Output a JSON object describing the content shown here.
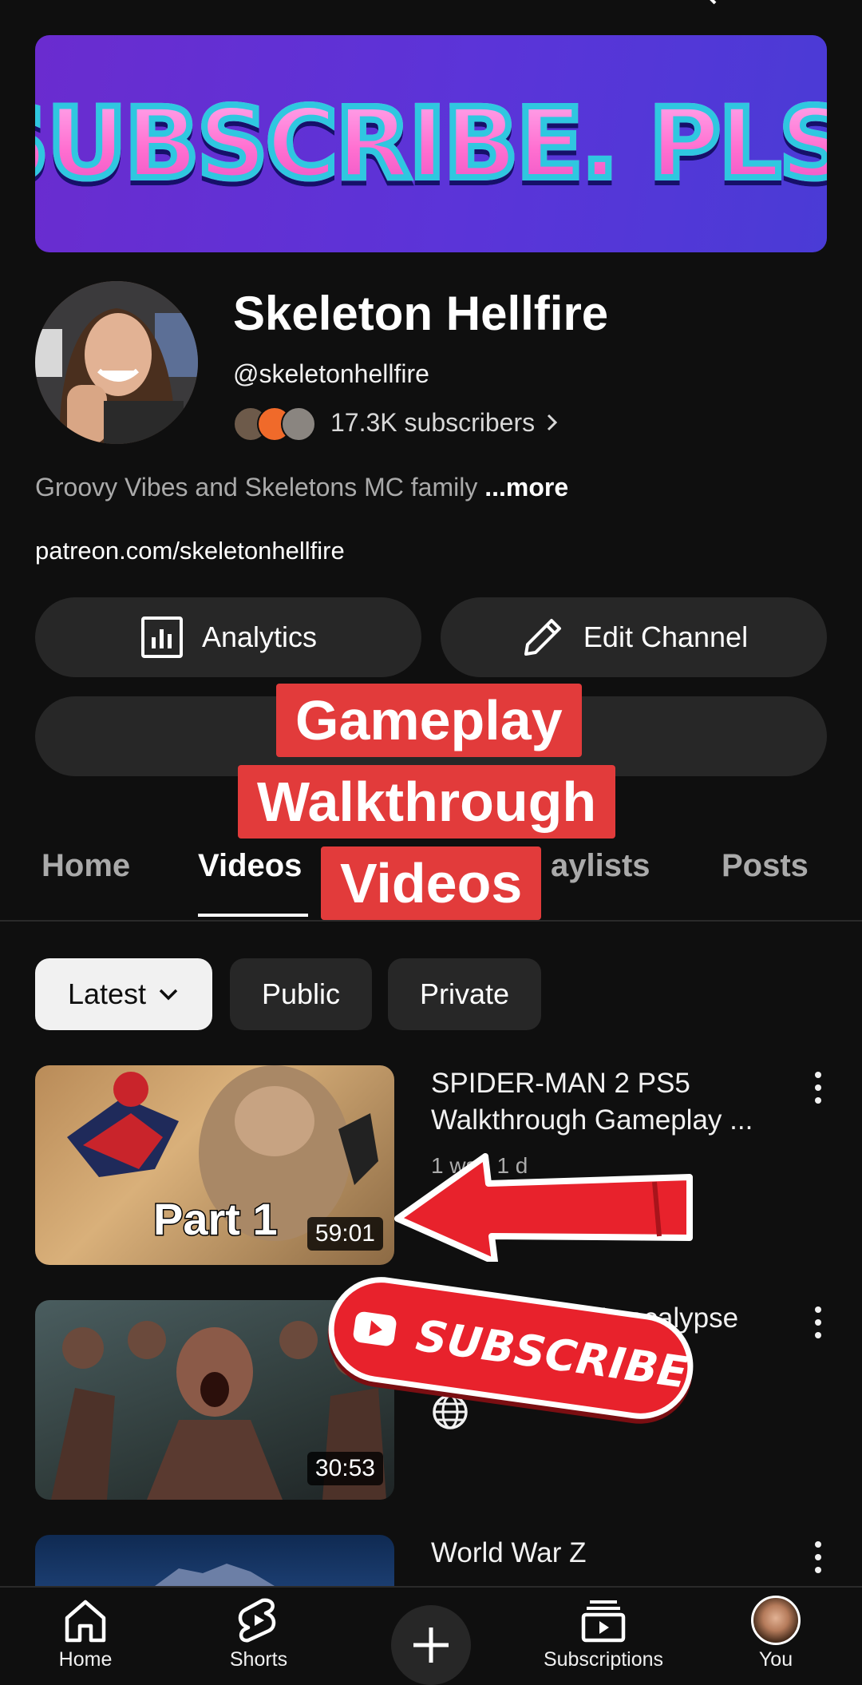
{
  "banner": {
    "text": "SUBSCRIBE. PLS."
  },
  "channel": {
    "name": "Skeleton Hellfire",
    "handle": "@skeletonhellfire",
    "subscribers": "17.3K subscribers",
    "description": "Groovy Vibes and Skeletons MC family ",
    "description_more": "...more",
    "link": "patreon.com/skeletonhellfire"
  },
  "buttons": {
    "analytics": "Analytics",
    "edit_channel": "Edit Channel"
  },
  "overlay_caption": [
    "Gameplay",
    "Walkthrough",
    "Videos"
  ],
  "tabs": [
    {
      "label": "Home",
      "active": false
    },
    {
      "label": "Videos",
      "active": true
    },
    {
      "label": "aylists",
      "active": false
    },
    {
      "label": "Posts",
      "active": false
    }
  ],
  "chips": [
    {
      "label": "Latest",
      "selected": true
    },
    {
      "label": "Public",
      "selected": false
    },
    {
      "label": "Private",
      "selected": false
    }
  ],
  "videos": [
    {
      "title": "SPIDER-MAN 2 PS5 Walkthrough Gameplay ...",
      "meta": "1 ws · 1 d",
      "duration": "59:01",
      "badge": "Part 1"
    },
    {
      "title": "The Apocalypse",
      "duration": "30:53"
    },
    {
      "title": "World War Z"
    }
  ],
  "subscribe_sticker": "SUBSCRIBE",
  "bottom_nav": [
    {
      "label": "Home"
    },
    {
      "label": "Shorts"
    },
    {
      "label": "Subscriptions"
    },
    {
      "label": "You"
    }
  ],
  "colors": {
    "background": "#0f0f0f",
    "chip": "#272727",
    "caption": "#e23b3b",
    "sticker": "#e8222c"
  }
}
